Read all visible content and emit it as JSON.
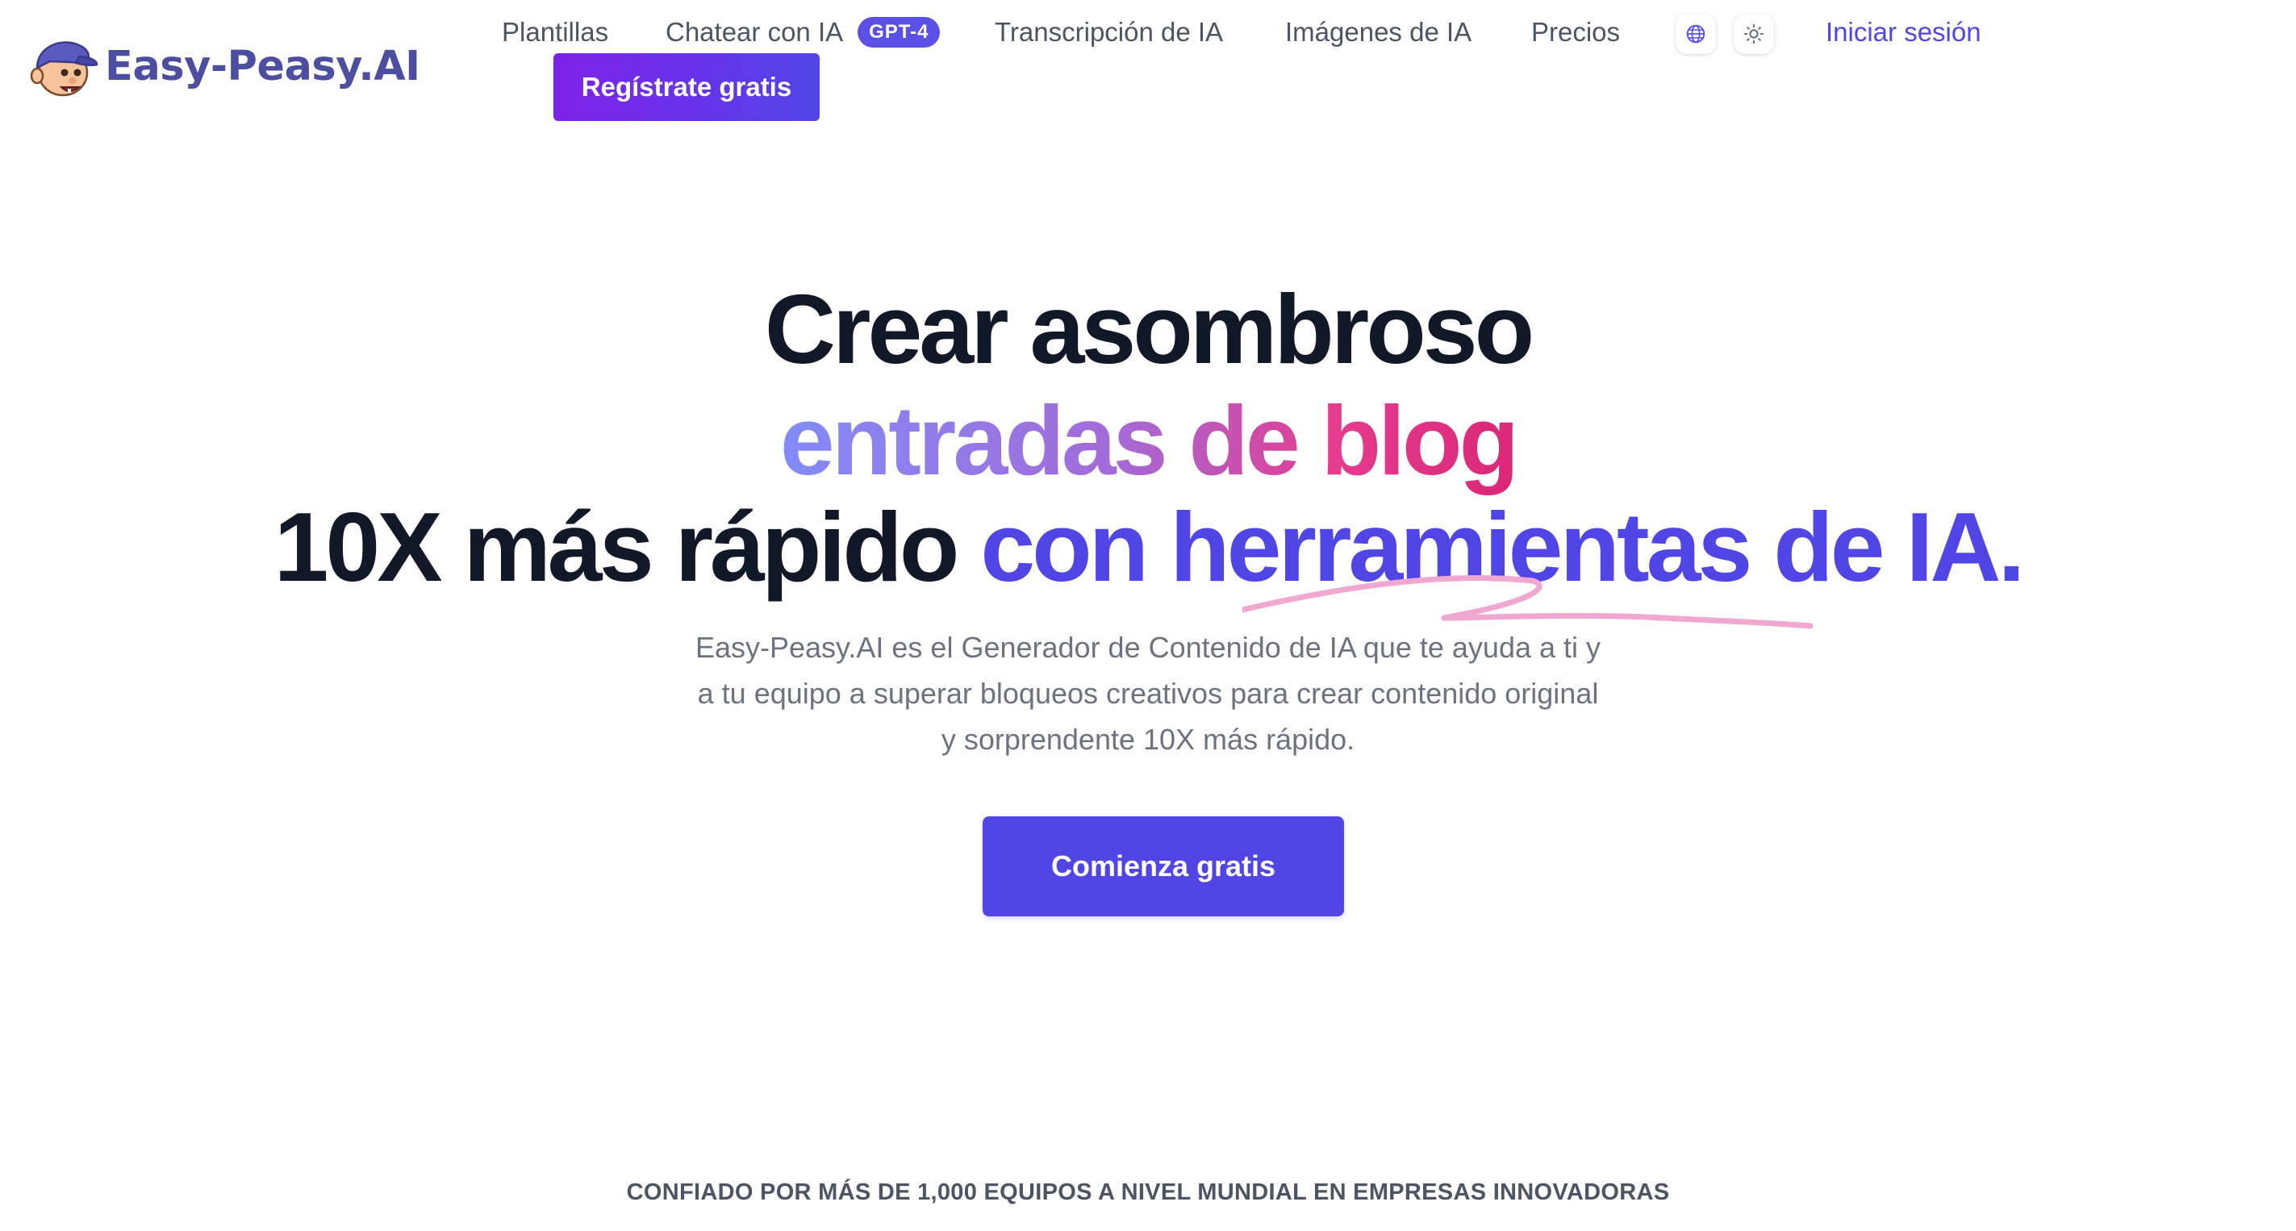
{
  "brand": {
    "name": "Easy-Peasy.AI",
    "logo_icon": "boy-mascot-icon",
    "color": "#4c4f9f"
  },
  "nav": {
    "items": [
      {
        "label": "Plantillas"
      },
      {
        "label": "Chatear con IA",
        "badge": "GPT-4"
      },
      {
        "label": "Transcripción de IA"
      },
      {
        "label": "Imágenes de IA"
      },
      {
        "label": "Precios"
      }
    ],
    "icons": [
      "globe-icon",
      "sun-icon"
    ],
    "login": "Iniciar sesión",
    "signup": "Regístrate gratis"
  },
  "hero": {
    "line1": "Crear asombroso",
    "line2": "entradas de blog",
    "line3_dark": "10X más rápido",
    "line3_accent": "con herramientas de IA.",
    "description": "Easy-Peasy.AI es el Generador de Contenido de IA que te ayuda a ti y a tu equipo a superar bloqueos creativos para crear contenido original y sorprendente 10X más rápido.",
    "cta": "Comienza gratis"
  },
  "trusted": "CONFIADO POR MÁS DE 1,000 EQUIPOS A NIVEL MUNDIAL EN EMPRESAS INNOVADORAS",
  "colors": {
    "accent": "#4f46e5",
    "dark_text": "#111827",
    "muted_text": "#6b7280",
    "badge": "#5b50e6",
    "squiggle": "#f0a8d0",
    "gradient": [
      "#818cf8",
      "#a26bd9",
      "#e53c8f",
      "#db2777"
    ],
    "signup_gradient": [
      "#7e22e8",
      "#5046e5"
    ]
  }
}
